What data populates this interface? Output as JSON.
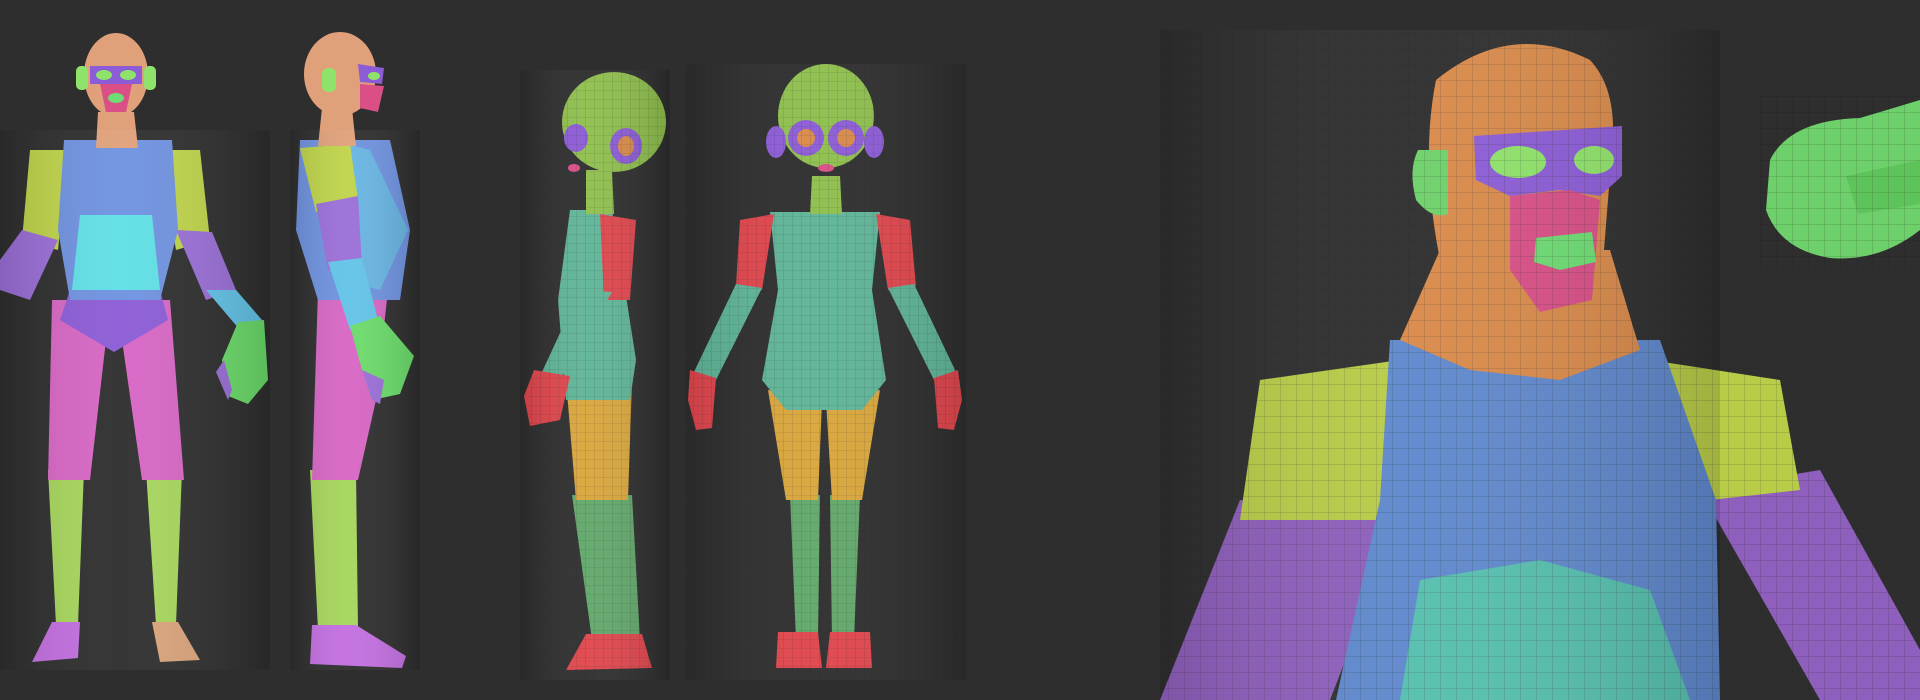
{
  "scene": {
    "background": "#2e2e2e",
    "polygroup_colors": {
      "skin": "#e0a17a",
      "mask": "#8c5cd6",
      "eye": "#8fe36a",
      "face_red": "#d94f86",
      "mouth": "#6ddc73",
      "torso_blue": "#6f92e0",
      "chest_cyan": "#5fe0e6",
      "shoulder_lime": "#bfd44a",
      "arm_violet": "#9b6fd8",
      "arm_cyan": "#63c4e8",
      "leg_pink": "#d766c4",
      "leg_lime": "#a6d65c",
      "hand_green": "#6bdc6a",
      "foot_violet": "#c36fe0",
      "female_teal": "#5fb598",
      "female_head": "#8fbf4d",
      "female_arm_red": "#e0464d",
      "female_thigh": "#d9a63c",
      "female_shin": "#62a86b",
      "closeup_head": "#d98a4a",
      "closeup_torso": "#5f88cc",
      "closeup_shoulder": "#b9cc48",
      "closeup_arm": "#8e5fbc",
      "closeup_chest": "#56bfae",
      "ear_green": "#6ed06a"
    },
    "figures": [
      "male-front-view",
      "male-side-view",
      "female-side-view",
      "female-front-view",
      "male-bust-closeup",
      "hand-closeup"
    ]
  }
}
